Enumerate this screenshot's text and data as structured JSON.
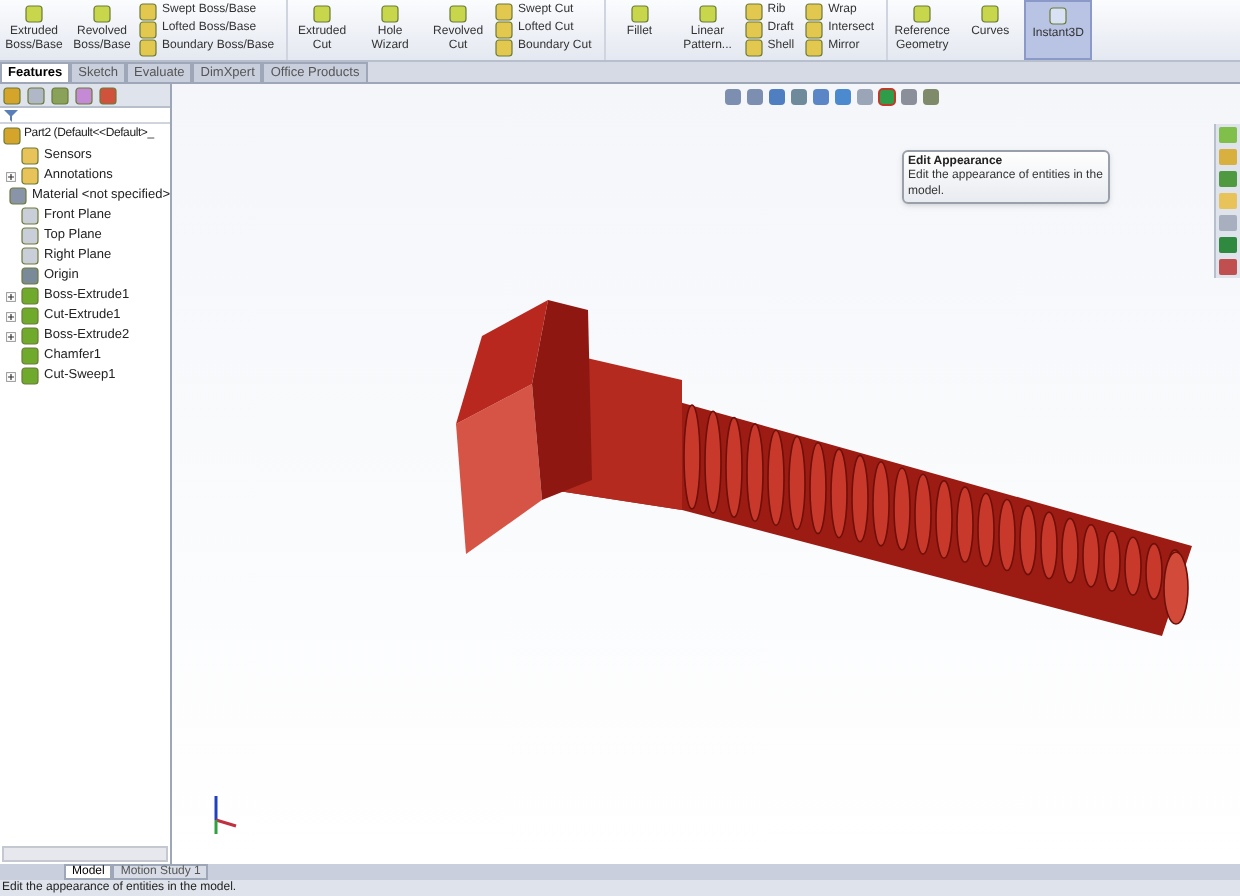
{
  "ribbon": {
    "groups": [
      {
        "kind": "large",
        "buttons": [
          {
            "label": "Extruded Boss/Base",
            "selected": false
          },
          {
            "label": "Revolved Boss/Base",
            "selected": false
          }
        ]
      },
      {
        "kind": "stack",
        "buttons": [
          {
            "label": "Swept Boss/Base"
          },
          {
            "label": "Lofted Boss/Base"
          },
          {
            "label": "Boundary Boss/Base"
          }
        ]
      },
      {
        "kind": "large",
        "buttons": [
          {
            "label": "Extruded Cut",
            "selected": false
          },
          {
            "label": "Hole Wizard",
            "selected": false
          },
          {
            "label": "Revolved Cut",
            "selected": false
          }
        ]
      },
      {
        "kind": "stack",
        "buttons": [
          {
            "label": "Swept Cut"
          },
          {
            "label": "Lofted Cut"
          },
          {
            "label": "Boundary Cut"
          }
        ]
      },
      {
        "kind": "large",
        "buttons": [
          {
            "label": "Fillet",
            "selected": false
          },
          {
            "label": "Linear Pattern...",
            "selected": false
          }
        ]
      },
      {
        "kind": "stack",
        "buttons": [
          {
            "label": "Rib"
          },
          {
            "label": "Draft"
          },
          {
            "label": "Shell"
          }
        ]
      },
      {
        "kind": "stack",
        "buttons": [
          {
            "label": "Wrap"
          },
          {
            "label": "Intersect"
          },
          {
            "label": "Mirror"
          }
        ]
      },
      {
        "kind": "large",
        "buttons": [
          {
            "label": "Reference Geometry",
            "selected": false
          },
          {
            "label": "Curves",
            "selected": false
          }
        ]
      },
      {
        "kind": "large",
        "buttons": [
          {
            "label": "Instant3D",
            "selected": true
          }
        ]
      }
    ]
  },
  "tabs": [
    {
      "label": "Features",
      "selected": true
    },
    {
      "label": "Sketch",
      "selected": false
    },
    {
      "label": "Evaluate",
      "selected": false
    },
    {
      "label": "DimXpert",
      "selected": false
    },
    {
      "label": "Office Products",
      "selected": false
    }
  ],
  "tree": {
    "label": "Part2 (Default<<Default>_",
    "children": [
      {
        "label": "Sensors",
        "kind": "folder",
        "collapsed": false
      },
      {
        "label": "Annotations",
        "kind": "folder",
        "collapsed": true
      },
      {
        "label": "Material <not specified>",
        "kind": "material",
        "collapsed": false
      },
      {
        "label": "Front Plane",
        "kind": "plane",
        "collapsed": false
      },
      {
        "label": "Top Plane",
        "kind": "plane",
        "collapsed": false
      },
      {
        "label": "Right Plane",
        "kind": "plane",
        "collapsed": false
      },
      {
        "label": "Origin",
        "kind": "origin",
        "collapsed": false
      },
      {
        "label": "Boss-Extrude1",
        "kind": "feature",
        "collapsed": true
      },
      {
        "label": "Cut-Extrude1",
        "kind": "feature",
        "collapsed": true
      },
      {
        "label": "Boss-Extrude2",
        "kind": "feature",
        "collapsed": true
      },
      {
        "label": "Chamfer1",
        "kind": "feature",
        "collapsed": false
      },
      {
        "label": "Cut-Sweep1",
        "kind": "feature",
        "collapsed": true
      }
    ]
  },
  "tooltip": {
    "title": "Edit Appearance",
    "text": "Edit the appearance of entities in the model."
  },
  "bottom_tabs": [
    {
      "label": "Model",
      "selected": true
    },
    {
      "label": "Motion Study 1",
      "selected": false
    }
  ],
  "status_bar": "Edit the appearance of entities in the model."
}
